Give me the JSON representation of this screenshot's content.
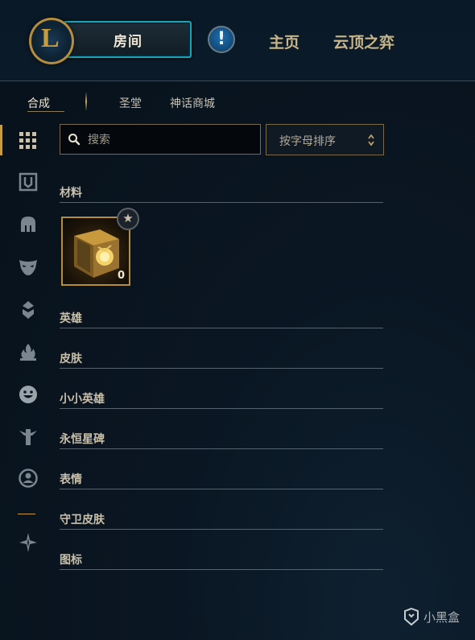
{
  "header": {
    "logo_letter": "L",
    "play_button_label": "房间",
    "alert_symbol": "!",
    "nav_items": [
      "主页",
      "云顶之弈"
    ]
  },
  "subtabs": [
    {
      "label": "合成",
      "active": true
    },
    {
      "label": "圣堂",
      "active": false
    },
    {
      "label": "神话商城",
      "active": false
    }
  ],
  "sidebar": {
    "icons": [
      "grid-icon",
      "chest-icon",
      "helmet-icon",
      "mask-icon",
      "emblem-icon",
      "flame-icon",
      "emote-face-icon",
      "totem-icon",
      "profile-icon",
      "ward-icon"
    ],
    "active_index": 0
  },
  "search": {
    "placeholder": "搜索",
    "value": ""
  },
  "sort": {
    "selected": "按字母排序"
  },
  "sections": [
    {
      "label": "材料"
    },
    {
      "label": "英雄"
    },
    {
      "label": "皮肤"
    },
    {
      "label": "小小英雄"
    },
    {
      "label": "永恒星碑"
    },
    {
      "label": "表情"
    },
    {
      "label": "守卫皮肤"
    },
    {
      "label": "图标"
    }
  ],
  "materials": {
    "items": [
      {
        "icon": "hextech-chest-icon",
        "count": "0",
        "badge": "★"
      }
    ]
  },
  "watermark": {
    "text": "小黑盒"
  },
  "colors": {
    "gold": "#c89b3c",
    "teal": "#1fa1b5",
    "bg": "#0a1622"
  }
}
